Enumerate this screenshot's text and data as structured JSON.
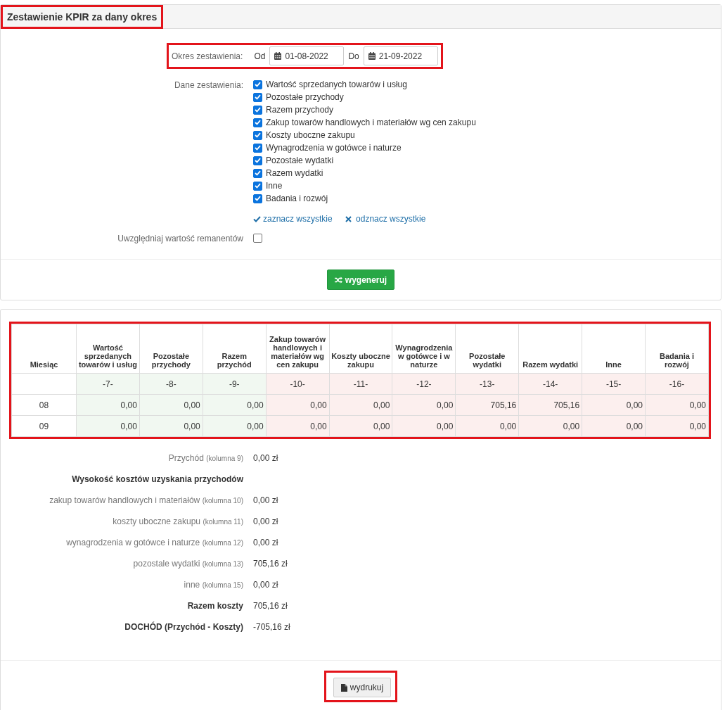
{
  "panel": {
    "title": "Zestawienie KPIR za dany okres",
    "highlighted": true
  },
  "period": {
    "label": "Okres zestawienia:",
    "from_label": "Od",
    "from": "01-08-2022",
    "to_label": "Do",
    "to": "21-09-2022",
    "highlighted": true
  },
  "data_options": {
    "label": "Dane zestawienia:",
    "items": [
      {
        "label": "Wartość sprzedanych towarów i usług",
        "checked": true
      },
      {
        "label": "Pozostałe przychody",
        "checked": true
      },
      {
        "label": "Razem przychody",
        "checked": true
      },
      {
        "label": "Zakup towarów handlowych i materiałów wg cen zakupu",
        "checked": true
      },
      {
        "label": "Koszty uboczne zakupu",
        "checked": true
      },
      {
        "label": "Wynagrodzenia w gotówce i naturze",
        "checked": true
      },
      {
        "label": "Pozostałe wydatki",
        "checked": true
      },
      {
        "label": "Razem wydatki",
        "checked": true
      },
      {
        "label": "Inne",
        "checked": true
      },
      {
        "label": "Badania i rozwój",
        "checked": true
      }
    ]
  },
  "select_all": "zaznacz wszystkie",
  "deselect_all": "odznacz wszystkie",
  "inventory": {
    "label": "Uwzględniaj wartość remanentów",
    "checked": false
  },
  "generate_button": "wygeneruj",
  "table": {
    "highlighted": true,
    "month_header": "Miesiąc",
    "columns": [
      {
        "header": "Wartość sprzedanych towarów i usług",
        "number": "-7-",
        "color": "#f1f8f1"
      },
      {
        "header": "Pozostałe przychody",
        "number": "-8-",
        "color": "#f1f8f1"
      },
      {
        "header": "Razem przychód",
        "number": "-9-",
        "color": "#f1f8f1"
      },
      {
        "header": "Zakup towarów handlowych i materiałów wg cen zakupu",
        "number": "-10-",
        "color": "#fcefee"
      },
      {
        "header": "Koszty uboczne zakupu",
        "number": "-11-",
        "color": "#fcefee"
      },
      {
        "header": "Wynagrodzenia w gotówce i w naturze",
        "number": "-12-",
        "color": "#fcefee"
      },
      {
        "header": "Pozostałe wydatki",
        "number": "-13-",
        "color": "#fcefee"
      },
      {
        "header": "Razem wydatki",
        "number": "-14-",
        "color": "#fcefee"
      },
      {
        "header": "Inne",
        "number": "-15-",
        "color": "#fcefee"
      },
      {
        "header": "Badania i rozwój",
        "number": "-16-",
        "color": "#fcefee"
      }
    ],
    "rows": [
      {
        "month": "08",
        "values": [
          "0,00",
          "0,00",
          "0,00",
          "0,00",
          "0,00",
          "0,00",
          "705,16",
          "705,16",
          "0,00",
          "0,00"
        ]
      },
      {
        "month": "09",
        "values": [
          "0,00",
          "0,00",
          "0,00",
          "0,00",
          "0,00",
          "0,00",
          "0,00",
          "0,00",
          "0,00",
          "0,00"
        ]
      }
    ]
  },
  "summary": [
    {
      "kind": "line",
      "label": "Przychód",
      "note": "(kolumna 9)",
      "value": "0,00 zł"
    },
    {
      "kind": "heading",
      "label": "Wysokość kosztów uzyskania przychodów"
    },
    {
      "kind": "line",
      "label": "zakup towarów handlowych i materiałów",
      "note": "(kolumna 10)",
      "value": "0,00 zł"
    },
    {
      "kind": "line",
      "label": "koszty uboczne zakupu",
      "note": "(kolumna 11)",
      "value": "0,00 zł"
    },
    {
      "kind": "line",
      "label": "wynagrodzenia w gotówce i naturze",
      "note": "(kolumna 12)",
      "value": "0,00 zł"
    },
    {
      "kind": "line",
      "label": "pozostale wydatki",
      "note": "(kolumna 13)",
      "value": "705,16 zł"
    },
    {
      "kind": "line",
      "label": "inne",
      "note": "(kolumna 15)",
      "value": "0,00 zł"
    },
    {
      "kind": "total",
      "label": "Razem koszty",
      "value": "705,16 zł"
    },
    {
      "kind": "total",
      "label": "DOCHÓD (Przychód - Koszty)",
      "value": "-705,16 zł"
    }
  ],
  "print_button": {
    "label": "wydrukuj",
    "highlighted": true
  }
}
